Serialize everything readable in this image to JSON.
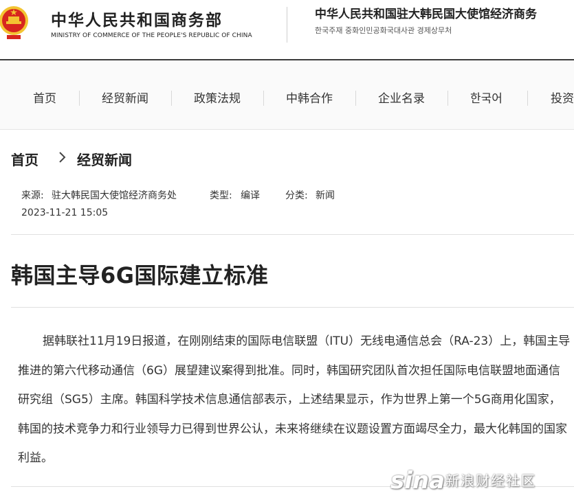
{
  "header": {
    "ministry_name_cn": "中华人民共和国商务部",
    "ministry_name_en": "MINISTRY OF COMMERCE OF THE PEOPLE'S REPUBLIC OF CHINA",
    "embassy_name_cn": "中华人民共和国驻大韩民国大使馆经济商务",
    "embassy_name_kr": "한국주재 중화인민공화국대사관 경제상무처",
    "emblem_icon": "national-emblem-icon",
    "colors": {
      "emblem_red": "#d7261e",
      "emblem_gold": "#f3c432"
    }
  },
  "nav": {
    "items": [
      {
        "label": "首页"
      },
      {
        "label": "经贸新闻"
      },
      {
        "label": "政策法规"
      },
      {
        "label": "中韩合作"
      },
      {
        "label": "企业名录"
      },
      {
        "label": "한국어"
      },
      {
        "label": "投资"
      }
    ]
  },
  "breadcrumb": {
    "home": "首页",
    "current": "经贸新闻",
    "separator_icon": "chevron-right-icon"
  },
  "meta": {
    "source_label": "来源:",
    "source_value": "驻大韩民国大使馆经济商务处",
    "type_label": "类型:",
    "type_value": "编译",
    "category_label": "分类:",
    "category_value": "新闻",
    "datetime": "2023-11-21 15:05"
  },
  "article": {
    "title": "韩国主导6G国际建立标准",
    "body": "据韩联社11月19日报道，在刚刚结束的国际电信联盟（ITU）无线电通信总会（RA-23）上，韩国主导推进的第六代移动通信（6G）展望建议案得到批准。同时，韩国研究团队首次担任国际电信联盟地面通信研究组（SG5）主席。韩国科学技术信息通信部表示，上述结果显示，作为世界上第一个5G商用化国家，韩国的技术竞争力和行业领导力已得到世界公认，未来将继续在议题设置方面竭尽全力，最大化韩国的国家利益。"
  },
  "watermark": {
    "logo": "sina",
    "text": "新浪财经社区"
  }
}
